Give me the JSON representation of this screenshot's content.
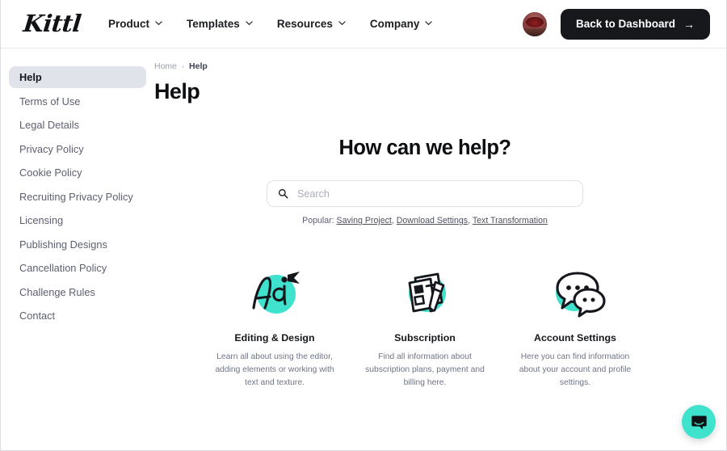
{
  "header": {
    "logo_text": "Kittl",
    "nav": [
      {
        "label": "Product",
        "icon": "chevron-down-icon"
      },
      {
        "label": "Templates",
        "icon": "chevron-down-icon"
      },
      {
        "label": "Resources",
        "icon": "chevron-down-icon"
      },
      {
        "label": "Company",
        "icon": "chevron-down-icon"
      }
    ],
    "avatar_name": "user-avatar",
    "cta_label": "Back to Dashboard",
    "cta_arrow": "→",
    "cta_bg": "#17181c"
  },
  "sidebar": {
    "items": [
      {
        "label": "Help",
        "active": true
      },
      {
        "label": "Terms of Use",
        "active": false
      },
      {
        "label": "Legal Details",
        "active": false
      },
      {
        "label": "Privacy Policy",
        "active": false
      },
      {
        "label": "Cookie Policy",
        "active": false
      },
      {
        "label": "Recruiting Privacy Policy",
        "active": false
      },
      {
        "label": "Licensing",
        "active": false
      },
      {
        "label": "Publishing Designs",
        "active": false
      },
      {
        "label": "Cancellation Policy",
        "active": false
      },
      {
        "label": "Challenge Rules",
        "active": false
      },
      {
        "label": "Contact",
        "active": false
      }
    ],
    "active_bg": "#e1e3eb"
  },
  "breadcrumb": {
    "home": "Home",
    "separator": "›",
    "current": "Help"
  },
  "page_title": "Help",
  "hero": {
    "heading": "How can we help?",
    "search": {
      "placeholder": "Search",
      "value": "",
      "icon": "search-icon"
    },
    "popular_label": "Popular:",
    "popular_links": [
      "Saving Project",
      "Download Settings",
      "Text Transformation"
    ]
  },
  "cards": [
    {
      "icon": "editing-design-icon",
      "title": "Editing & Design",
      "description": "Learn all about using the editor, adding elements or working with text and texture."
    },
    {
      "icon": "subscription-icon",
      "title": "Subscription",
      "description": "Find all information about subscription plans, payment and billing here."
    },
    {
      "icon": "account-settings-icon",
      "title": "Account Settings",
      "description": "Here you can find information about your account and profile settings."
    }
  ],
  "chat_widget": {
    "icon": "chat-bubble-icon",
    "color": "#3fe3cd"
  },
  "accent_color": "#3fe3cd"
}
